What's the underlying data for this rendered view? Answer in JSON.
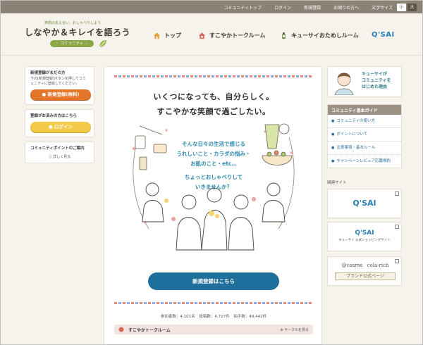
{
  "topbar": {
    "links": [
      "コミュニティトップ",
      "ログイン",
      "新規登録",
      "お困りの方へ"
    ],
    "text_size_label": "文字サイズ",
    "size_small": "小",
    "size_large": "大"
  },
  "header": {
    "logo_tagline": "笑顔の支え合い、おしゃべりしよう",
    "logo_main": "しなやか＆キレイを語ろう",
    "logo_sub": "・ コミュニティ ・",
    "nav": [
      {
        "label": "トップ",
        "icon": "house-icon"
      },
      {
        "label": "すこやかトークルーム",
        "icon": "chat-house-icon"
      },
      {
        "label": "キューサイおためしルーム",
        "icon": "bottle-icon"
      }
    ],
    "brand": "Q'SAI"
  },
  "left_sidebar": {
    "register_box": {
      "title": "新規登録がまだの方",
      "text": "下の[新規登録]ボタンを押してコミュニティに登録してください。",
      "button": "新規登録(無料)"
    },
    "login_box": {
      "title": "登録がお済みの方はこちら",
      "button": "ログイン"
    },
    "points_box": {
      "title": "コミュニティポイントのご案内",
      "link": "詳しく見る"
    }
  },
  "main": {
    "headline_1": "いくつになっても、自分らしく。",
    "headline_2": "すこやかな笑顔で過ごしたい。",
    "body_lines": [
      "そんな日々の生活で感じる",
      "うれしいこと・カラダの悩み・",
      "お肌のこと・etc…",
      "ちょっとおしゃべりして",
      "いきませんか？"
    ],
    "cta": "新規登録はこちら",
    "stats": {
      "members": "参加者数：4,101名",
      "posts": "投稿数：4,727件",
      "claps": "拍手数：48,442件"
    },
    "room_bar": {
      "title": "すこやかトークルーム",
      "more": "サークルを見る"
    }
  },
  "right_sidebar": {
    "banner": {
      "line1": "キューサイが",
      "line2": "コミュニティを",
      "line3": "はじめた理由"
    },
    "guide": {
      "title": "コミュニティ基本ガイド",
      "items": [
        "コミュニティの使い方",
        "ポイントについて",
        "注意事項・基本ルール",
        "キャンペーンレビュア応募規約"
      ]
    },
    "related_label": "関連サイト",
    "related_sites": [
      {
        "logo": "Q'SAI"
      },
      {
        "logo": "Q'SAI",
        "sub": "キューサイ 公式ショッピングサイト"
      }
    ],
    "cosme": {
      "left": "@cosme",
      "right": "cola-rich",
      "button": "ブランド公式ページ"
    }
  },
  "colors": {
    "topbar": "#8b8275",
    "accent_orange": "#e4762a",
    "accent_yellow": "#f3c94a",
    "cta_blue": "#1f6f9c",
    "text_blue": "#2d8ab0",
    "link_blue": "#2a6e9c"
  }
}
